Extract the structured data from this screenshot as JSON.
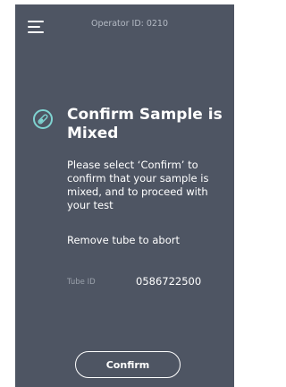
{
  "header": {
    "menu_icon": "hamburger-menu-icon",
    "operator_label": "Operator ID: 0210"
  },
  "main": {
    "status_icon": "test-tube-icon",
    "title": "Confirm Sample is Mixed",
    "instructions": "Please select ‘Confirm’ to confirm that your sample is mixed, and to proceed with your test",
    "abort_text": "Remove tube to abort",
    "tube_id_label": "Tube ID",
    "tube_id_value": "0586722500"
  },
  "footer": {
    "confirm_label": "Confirm"
  },
  "colors": {
    "background": "#4e5563",
    "accent": "#7fd3d1",
    "text": "#ffffff",
    "muted_text": "#9aa1ab"
  }
}
